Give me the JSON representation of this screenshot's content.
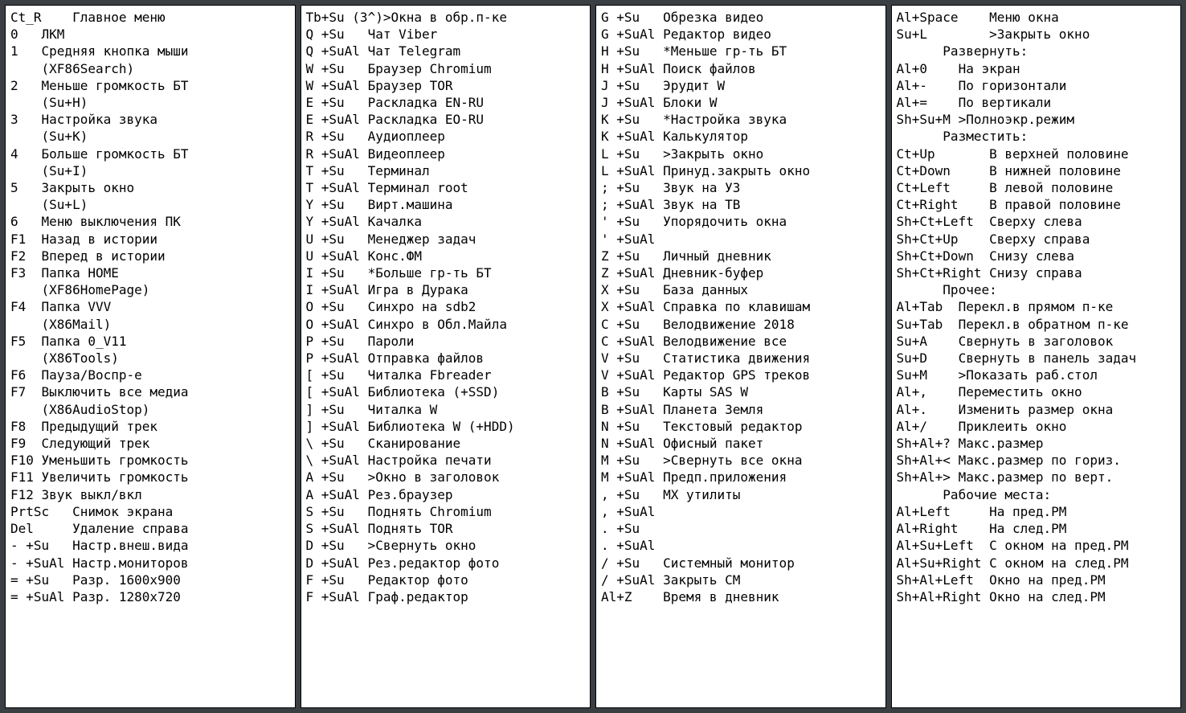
{
  "panels": [
    {
      "id": "col1",
      "lines": [
        "Ct_R    Главное меню",
        "0   ЛКМ",
        "1   Средняя кнопка мыши",
        "    (XF86Search)",
        "2   Меньше громкость БТ",
        "    (Su+H)",
        "3   Настройка звука",
        "    (Su+K)",
        "4   Больше громкость БТ",
        "    (Su+I)",
        "5   Закрыть окно",
        "    (Su+L)",
        "6   Меню выключения ПК",
        "F1  Назад в истории",
        "F2  Вперед в истории",
        "F3  Папка HOME",
        "    (XF86HomePage)",
        "F4  Папка VVV",
        "    (X86Mail)",
        "F5  Папка 0_V11",
        "    (X86Tools)",
        "F6  Пауза/Воспр-е",
        "F7  Выключить все медиа",
        "    (X86AudioStop)",
        "F8  Предыдущий трек",
        "F9  Следующий трек",
        "F10 Уменьшить громкость",
        "F11 Увеличить громкость",
        "F12 Звук выкл/вкл",
        "PrtSc   Снимок экрана",
        "Del     Удаление справа",
        "- +Su   Настр.внеш.вида",
        "- +SuAl Настр.мониторов",
        "= +Su   Разр. 1600x900",
        "= +SuAl Разр. 1280x720"
      ]
    },
    {
      "id": "col2",
      "lines": [
        "Tb+Su (3^)>Окна в обр.п-ке",
        "Q +Su   Чат Viber",
        "Q +SuAl Чат Telegram",
        "W +Su   Браузер Chromium",
        "W +SuAl Браузер TOR",
        "E +Su   Раскладка EN-RU",
        "E +SuAl Раскладка EO-RU",
        "R +Su   Аудиоплеер",
        "R +SuAl Видеоплеер",
        "T +Su   Терминал",
        "T +SuAl Терминал root",
        "Y +Su   Вирт.машина",
        "Y +SuAl Качалка",
        "U +Su   Менеджер задач",
        "U +SuAl Конс.ФМ",
        "I +Su   *Больше гр-ть БТ",
        "I +SuAl Игра в Дурака",
        "O +Su   Синхро на sdb2",
        "O +SuAl Синхро в Обл.Майла",
        "P +Su   Пароли",
        "P +SuAl Отправка файлов",
        "[ +Su   Читалка Fbreader",
        "[ +SuAl Библиотека (+SSD)",
        "] +Su   Читалка W",
        "] +SuAl Библиотека W (+HDD)",
        "\\ +Su   Сканирование",
        "\\ +SuAl Настройка печати",
        "A +Su   >Окно в заголовок",
        "A +SuAl Рез.браузер",
        "S +Su   Поднять Chromium",
        "S +SuAl Поднять TOR",
        "D +Su   >Свернуть окно",
        "D +SuAl Рез.редактор фото",
        "F +Su   Редактор фото",
        "F +SuAl Граф.редактор"
      ]
    },
    {
      "id": "col3",
      "lines": [
        "G +Su   Обрезка видео",
        "G +SuAl Редактор видео",
        "H +Su   *Меньше гр-ть БТ",
        "H +SuAl Поиск файлов",
        "J +Su   Эрудит W",
        "J +SuAl Блоки W",
        "K +Su   *Настройка звука",
        "K +SuAl Калькулятор",
        "L +Su   >Закрыть окно",
        "L +SuAl Принуд.закрыть окно",
        "; +Su   Звук на УЗ",
        "; +SuAl Звук на ТВ",
        "' +Su   Упорядочить окна",
        "' +SuAl",
        "Z +Su   Личный дневник",
        "Z +SuAl Дневник-буфер",
        "X +Su   База данных",
        "X +SuAl Справка по клавишам",
        "C +Su   Велодвижение 2018",
        "C +SuAl Велодвижение все",
        "V +Su   Статистика движения",
        "V +SuAl Редактор GPS треков",
        "B +Su   Карты SAS W",
        "B +SuAl Планета Земля",
        "N +Su   Текстовый редактор",
        "N +SuAl Офисный пакет",
        "M +Su   >Свернуть все окна",
        "M +SuAl Предп.приложения",
        ", +Su   MX утилиты",
        ", +SuAl",
        ". +Su",
        ". +SuAl",
        "/ +Su   Системный монитор",
        "/ +SuAl Закрыть СМ",
        "Al+Z    Время в дневник"
      ]
    },
    {
      "id": "col4",
      "lines": [
        "Al+Space    Меню окна",
        "Su+L        >Закрыть окно",
        "      Развернуть:",
        "Al+0    На экран",
        "Al+-    По горизонтали",
        "Al+=    По вертикали",
        "Sh+Su+M >Полноэкр.режим",
        "      Разместить:",
        "Ct+Up       В верхней половине",
        "Ct+Down     В нижней половине",
        "Ct+Left     В левой половине",
        "Ct+Right    В правой половине",
        "Sh+Ct+Left  Сверху слева",
        "Sh+Ct+Up    Сверху справа",
        "Sh+Ct+Down  Снизу слева",
        "Sh+Ct+Right Снизу справа",
        "      Прочее:",
        "Al+Tab  Перекл.в прямом п-ке",
        "Su+Tab  Перекл.в обратном п-ке",
        "Su+A    Свернуть в заголовок",
        "Su+D    Свернуть в панель задач",
        "Su+M    >Показать раб.стол",
        "Al+,    Переместить окно",
        "Al+.    Изменить размер окна",
        "Al+/    Приклеить окно",
        "Sh+Al+? Макс.размер",
        "Sh+Al+< Макс.размер по гориз.",
        "Sh+Al+> Макс.размер по верт.",
        "      Рабочие места:",
        "Al+Left     На пред.РМ",
        "Al+Right    На след.РМ",
        "Al+Su+Left  С окном на пред.РМ",
        "Al+Su+Right С окном на след.РМ",
        "Sh+Al+Left  Окно на пред.РМ",
        "Sh+Al+Right Окно на след.РМ"
      ]
    }
  ]
}
